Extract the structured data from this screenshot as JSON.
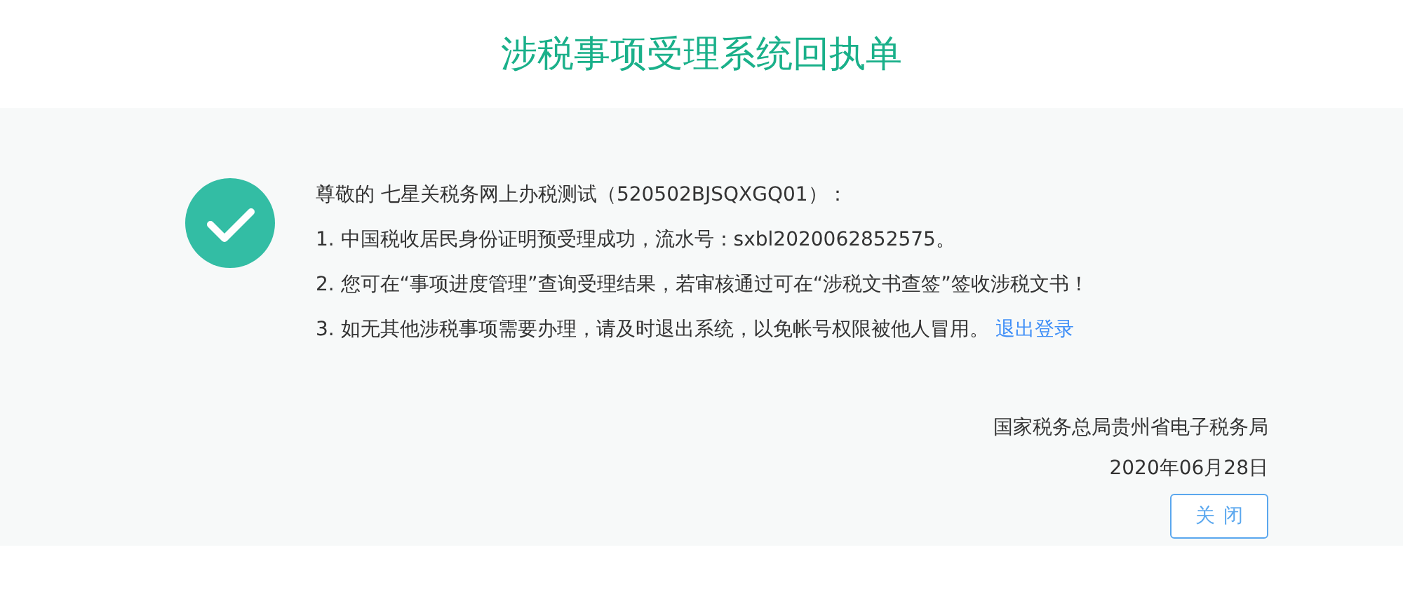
{
  "title": "涉税事项受理系统回执单",
  "receipt": {
    "succeeded": true,
    "greeting": "尊敬的 七星关税务网上办税测试（520502BJSQXGQ01）：",
    "lines": [
      {
        "text": "1. 中国税收居民身份证明预受理成功，流水号：sxbl2020062852575。"
      },
      {
        "text": "2. 您可在“事项进度管理”查询受理结果，若审核通过可在“涉税文书查签”签收涉税文书！"
      },
      {
        "text": "3. 如无其他涉税事项需要办理，请及时退出系统，以免帐号权限被他人冒用。",
        "link": "退出登录"
      }
    ],
    "issuer": "国家税务总局贵州省电子税务局",
    "date": "2020年06月28日",
    "button": "关闭"
  }
}
